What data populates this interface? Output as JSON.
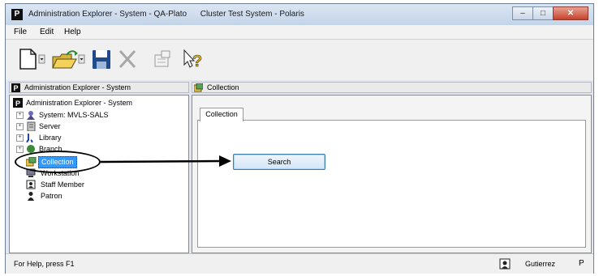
{
  "window": {
    "title": "Administration Explorer - System - QA-Plato      Cluster Test System - Polaris",
    "app_icon_letter": "P",
    "min_label": "–",
    "max_label": "□",
    "close_label": "✕"
  },
  "menu": [
    "File",
    "Edit",
    "Help"
  ],
  "toolbar": {
    "icons": [
      "new-icon",
      "open-folder-icon",
      "save-icon",
      "delete-icon",
      "properties-icon",
      "help-icon"
    ]
  },
  "left_pane": {
    "header": "Administration Explorer - System",
    "root": "Administration Explorer - System",
    "items": [
      {
        "label": "System: MVLS-SALS",
        "expander": "+"
      },
      {
        "label": "Server",
        "expander": "+"
      },
      {
        "label": "Library",
        "expander": "+"
      },
      {
        "label": "Branch",
        "expander": "+"
      },
      {
        "label": "Collection",
        "expander": ""
      },
      {
        "label": "Workstation",
        "expander": ""
      },
      {
        "label": "Staff Member",
        "expander": ""
      },
      {
        "label": "Patron",
        "expander": ""
      }
    ]
  },
  "right_pane": {
    "header": "Collection",
    "tab": "Collection",
    "search_button": "Search"
  },
  "status": {
    "text": "For Help, press F1",
    "user": "Gutierrez",
    "extra": "P"
  }
}
